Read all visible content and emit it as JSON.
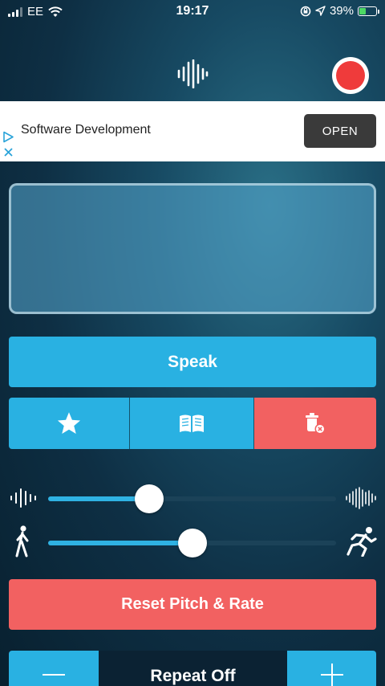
{
  "status_bar": {
    "carrier": "EE",
    "time": "19:17",
    "battery_percent": "39%",
    "battery_level": 0.39,
    "icons": [
      "signal-icon",
      "wifi-icon",
      "orientation-lock-icon",
      "location-icon",
      "battery-charging-icon"
    ]
  },
  "header": {
    "logo_icon": "waveform-icon",
    "record_icon": "record-icon",
    "record_color": "#ef3b3b"
  },
  "ad": {
    "title": "Software Development",
    "open_label": "OPEN",
    "icons": [
      "ad-choices-icon",
      "ad-close-icon"
    ]
  },
  "text_input": {
    "value": "",
    "placeholder": ""
  },
  "speak": {
    "label": "Speak"
  },
  "actions": {
    "favorite_icon": "star-icon",
    "library_icon": "book-icon",
    "clear_icon": "trash-icon"
  },
  "sliders": {
    "pitch": {
      "value": 0.35,
      "min_icon": "low-pitch-waveform-icon",
      "max_icon": "high-pitch-waveform-icon"
    },
    "rate": {
      "value": 0.5,
      "min_icon": "walking-icon",
      "max_icon": "running-icon"
    }
  },
  "reset": {
    "label": "Reset Pitch & Rate"
  },
  "repeat": {
    "label": "Repeat Off",
    "minus_icon": "minus-icon",
    "plus_icon": "plus-icon"
  },
  "colors": {
    "accent": "#29b1e2",
    "danger": "#f26161"
  }
}
